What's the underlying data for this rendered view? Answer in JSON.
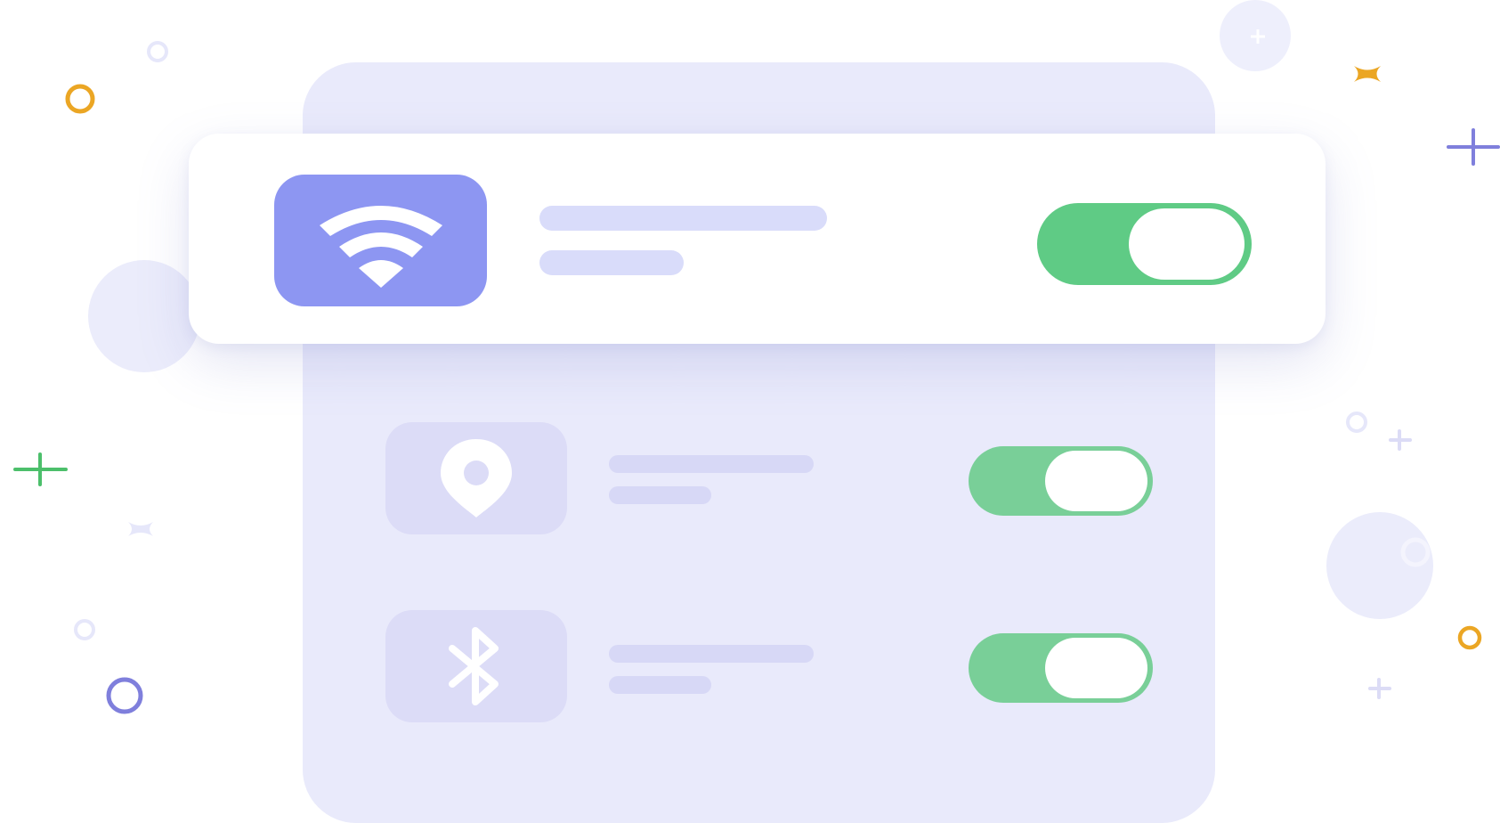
{
  "colors": {
    "background": "#ffffff",
    "phone_panel": "#e9eafb",
    "accent": "#8d96f2",
    "muted_tile": "#dcdcf7",
    "toggle_on": "#5fcb85",
    "toggle_on_muted": "#79cf98",
    "placeholder": "#d9dcfa",
    "placeholder_muted": "#d7d8f6",
    "deco_orange": "#eba624",
    "deco_green": "#4cbf6b",
    "deco_purple": "#7f7fdc"
  },
  "settings": [
    {
      "icon": "wifi-icon",
      "enabled": true,
      "featured": true
    },
    {
      "icon": "location-pin-icon",
      "enabled": true,
      "featured": false
    },
    {
      "icon": "bluetooth-icon",
      "enabled": true,
      "featured": false
    }
  ]
}
